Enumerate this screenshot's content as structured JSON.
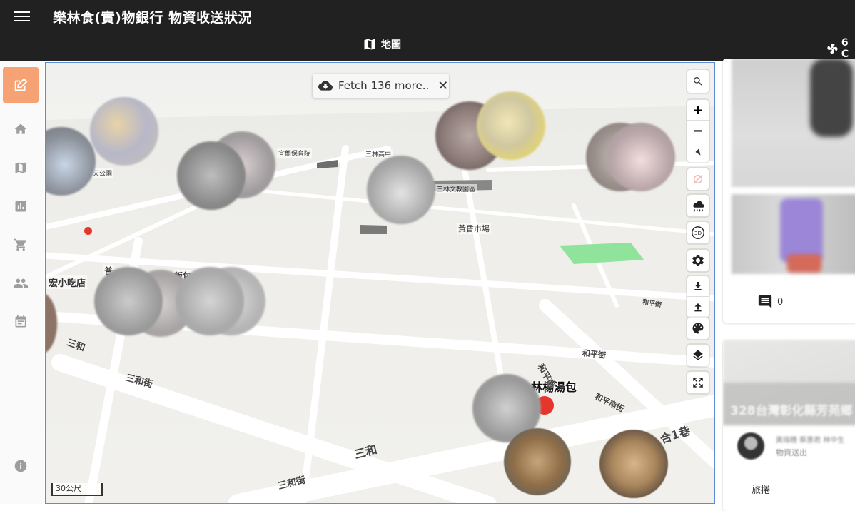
{
  "appbar": {
    "title": "樂林食(實)物銀行 物資收送狀況",
    "tab_map_label": "地圖",
    "tab_right_label": "6 C"
  },
  "sidebar": {
    "items": [
      {
        "icon": "edit-icon",
        "active": true
      },
      {
        "icon": "home-icon"
      },
      {
        "icon": "map-icon"
      },
      {
        "icon": "bar-chart-icon"
      },
      {
        "icon": "cart-icon"
      },
      {
        "icon": "people-icon"
      },
      {
        "icon": "calendar-icon"
      },
      {
        "icon": "info-icon"
      }
    ]
  },
  "map": {
    "fetch_label": "Fetch 136 more..",
    "scale_label": "30公尺",
    "places": {
      "p1": "宜蘭保育院",
      "p2": "三林高中",
      "p3": "三林文教園區",
      "p4": "黃昏市場",
      "p5": "天公園",
      "p6": "宏小吃店",
      "p7": "普",
      "p8": "飯包",
      "landmark": "林楊湯包"
    },
    "roads": {
      "r1": "三和街",
      "r2": "三和街",
      "r3": "三和",
      "r4": "和平街",
      "r5": "和平街",
      "r6": "和平南街",
      "r7": "三和",
      "r8": "和平南",
      "r9": "合1巷"
    }
  },
  "right_panel": {
    "comment_count": "0",
    "map_caption": "328台灣彰化縣芳苑鄉",
    "post_meta": "黃瑞穗 蔡惠君 林中生",
    "post_subtitle": "物資送出",
    "post_footer": "旅捲"
  },
  "colors": {
    "appbar": "#212121",
    "accent": "#f7a275",
    "map_border": "#5b8ad6",
    "marker_red": "#e5352d"
  }
}
